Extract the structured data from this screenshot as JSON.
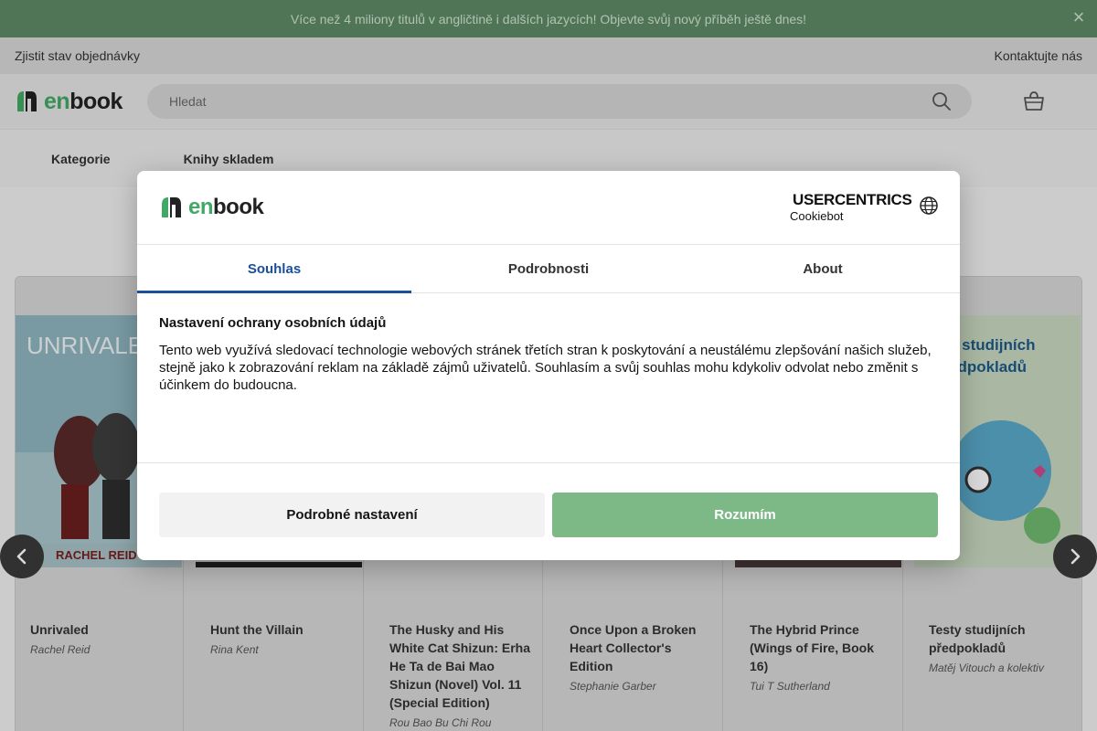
{
  "promo": {
    "text": "Více než 4 miliony titulů v angličtině i dalších jazycích! Objevte svůj nový příběh ještě dnes!",
    "close": "×"
  },
  "topbar": {
    "order_status": "Zjistit stav objednávky",
    "contact": "Kontaktujte nás"
  },
  "header": {
    "logo_en": "en",
    "logo_book": "book",
    "search_placeholder": "Hledat"
  },
  "nav": {
    "items": [
      "Kategorie",
      "Knihy skladem"
    ]
  },
  "books": [
    {
      "title": "Unrivaled",
      "author": "Rachel Reid"
    },
    {
      "title": "Hunt the Villain",
      "author": "Rina Kent"
    },
    {
      "title": "The Husky and His White Cat Shizun: Erha He Ta de Bai Mao Shizun (Novel) Vol. 11 (Special Edition)",
      "author": "Rou Bao Bu Chi Rou"
    },
    {
      "title": "Once Upon a Broken Heart Collector's Edition",
      "author": "Stephanie Garber"
    },
    {
      "title": "The Hybrid Prince (Wings of Fire, Book 16)",
      "author": "Tui T Sutherland"
    },
    {
      "title": "Testy studijních předpokladů",
      "author": "Matěj Vitouch a kolektiv"
    }
  ],
  "covers": {
    "unrivaled_title": "UNRIVALED",
    "unrivaled_author": "RACHEL REID",
    "testy_title_1": "y studijních",
    "testy_title_2": "edpokladů"
  },
  "modal": {
    "brand_uc": "USERCENTRICS",
    "brand_cb": "Cookiebot",
    "tabs": [
      "Souhlas",
      "Podrobnosti",
      "About"
    ],
    "active_tab": "Souhlas",
    "heading": "Nastavení ochrany osobních údajů",
    "body": "Tento web využívá sledovací technologie webových stránek třetích stran k poskytování a neustálému zlepšování našich služeb, stejně jako k zobrazování reklam na základě zájmů uživatelů. Souhlasím a svůj souhlas mohu kdykoliv odvolat nebo změnit s účinkem do budoucna.",
    "btn_details": "Podrobné nastavení",
    "btn_accept": "Rozumím"
  },
  "colors": {
    "brand_green": "#41a866",
    "accent_blue": "#1a4f9c",
    "accept_green": "#7db987",
    "promo_bg": "#5e8a65"
  }
}
